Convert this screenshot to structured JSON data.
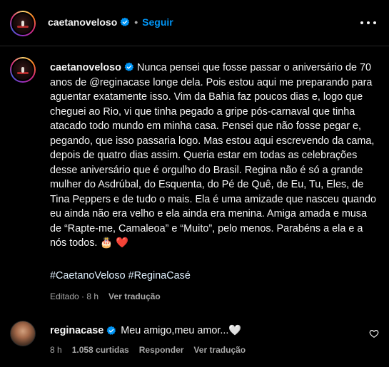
{
  "header": {
    "username": "caetanoveloso",
    "separator": "•",
    "follow_label": "Seguir"
  },
  "caption": {
    "username": "caetanoveloso",
    "text": "Nunca pensei que fosse passar o aniversário de 70 anos de @reginacase longe dela. Pois estou aqui me preparando para aguentar exatamente isso. Vim da Bahia faz poucos dias e, logo que cheguei ao Rio, vi que tinha pegado a gripe pós-carnaval que tinha atacado todo mundo em minha casa. Pensei que não fosse pegar e, pegando, que isso passaria logo. Mas estou aqui escrevendo da cama, depois de quatro dias assim. Queria estar em todas as celebrações desse aniversário que é orgulho do Brasil. Regina não é só a grande mulher do Asdrúbal, do Esquenta, do Pé de Quê, de Eu, Tu, Eles, de Tina Peppers e de tudo o mais. Ela é uma amizade que nasceu quando eu ainda não era velho e ela ainda era menina. Amiga amada e musa de “Rapte-me, Camaleoa” e “Muito”, pelo menos. Parabéns a ela e a nós todos. 🎂 ❤️",
    "hashtags": [
      "#CaetanoVeloso",
      "#ReginaCasé"
    ],
    "edited_label": "Editado · 8 h",
    "translate_label": "Ver tradução"
  },
  "comment": {
    "username": "reginacase",
    "text": "Meu amigo,meu amor...🤍",
    "time": "8 h",
    "likes": "1.058 curtidas",
    "reply_label": "Responder",
    "translate_label": "Ver tradução"
  },
  "icons": {
    "verified": "verified-badge-icon",
    "more": "more-options-icon",
    "like": "heart-outline-icon"
  },
  "colors": {
    "background": "#000000",
    "link_blue": "#0095f6",
    "hashtag": "#e0f1ff",
    "muted": "#a8a8a8",
    "verified": "#0095f6"
  }
}
